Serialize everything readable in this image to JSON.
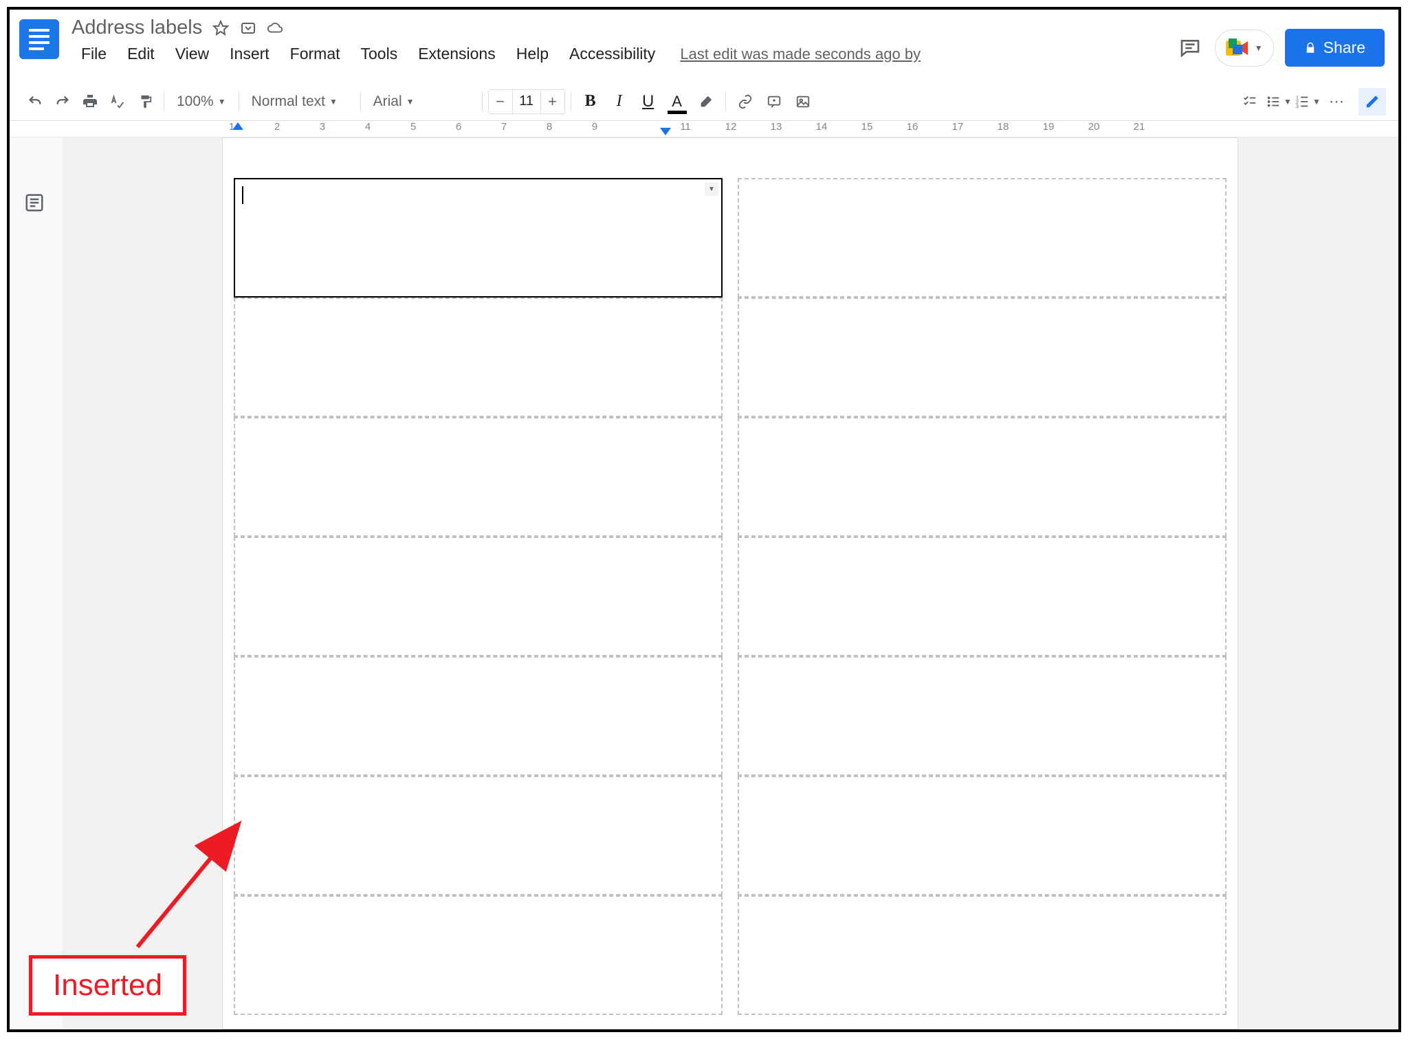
{
  "header": {
    "title": "Address labels",
    "edit_status": "Last edit was made seconds ago by"
  },
  "menu": {
    "file": "File",
    "edit": "Edit",
    "view": "View",
    "insert": "Insert",
    "format": "Format",
    "tools": "Tools",
    "extensions": "Extensions",
    "help": "Help",
    "accessibility": "Accessibility"
  },
  "share": {
    "label": "Share"
  },
  "toolbar": {
    "zoom": "100%",
    "style": "Normal text",
    "font": "Arial",
    "font_size": "11"
  },
  "ruler": {
    "ticks": [
      "1",
      "2",
      "3",
      "4",
      "5",
      "6",
      "7",
      "8",
      "9",
      "",
      "11",
      "12",
      "13",
      "14",
      "15",
      "16",
      "17",
      "18",
      "19",
      "20",
      "21"
    ]
  },
  "annotation": {
    "text": "Inserted"
  }
}
